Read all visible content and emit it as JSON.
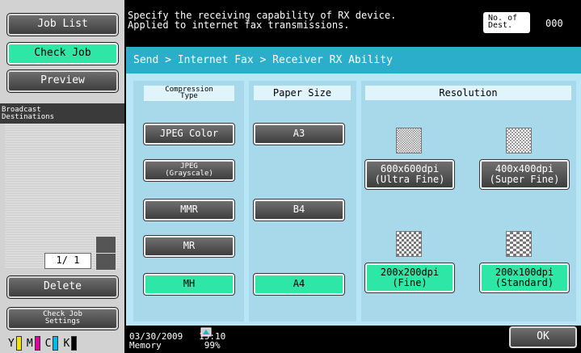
{
  "sidebar": {
    "job_list": "Job List",
    "check_job": "Check Job",
    "preview": "Preview",
    "broadcast_header": "Broadcast\nDestinations",
    "page": "1/ 1",
    "delete": "Delete",
    "check_job_settings": "Check Job\nSettings",
    "toner": [
      {
        "label": "Y",
        "color": "#f2e400"
      },
      {
        "label": "M",
        "color": "#e000a0"
      },
      {
        "label": "C",
        "color": "#00b8ea"
      },
      {
        "label": "K",
        "color": "#000000"
      }
    ]
  },
  "header": {
    "message": "Specify the receiving capability of RX device.\nApplied to internet fax transmissions.",
    "dest_label": "No. of\nDest.",
    "dest_count": "000"
  },
  "panel": {
    "breadcrumb": "Send > Internet Fax > Receiver RX Ability",
    "compression": {
      "header": "Compression\nType",
      "options": [
        "JPEG Color",
        "JPEG\n(Grayscale)",
        "MMR",
        "MR",
        "MH"
      ],
      "selected": "MH"
    },
    "paper": {
      "header": "Paper Size",
      "options": [
        "A3",
        "B4",
        "A4"
      ],
      "selected": "A4"
    },
    "resolution": {
      "header": "Resolution",
      "options": [
        {
          "label": "600x600dpi\n(Ultra Fine)",
          "selected": false
        },
        {
          "label": "400x400dpi\n(Super Fine)",
          "selected": false
        },
        {
          "label": "200x200dpi\n(Fine)",
          "selected": true
        },
        {
          "label": "200x100dpi\n(Standard)",
          "selected": true
        }
      ]
    }
  },
  "footer": {
    "datetime": "03/30/2009   15:10",
    "memory": "Memory        99%",
    "ok": "OK"
  },
  "colors": {
    "accent": "#2aaec9",
    "selected": "#2ee6a6",
    "panel_bg": "#b7e6f6"
  }
}
